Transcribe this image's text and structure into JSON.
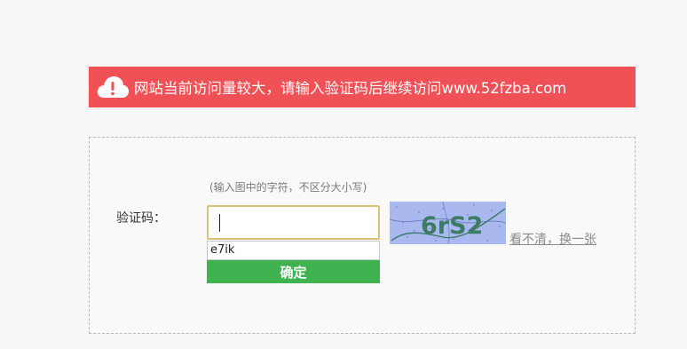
{
  "banner": {
    "icon": "cloud-alert-icon",
    "message": "网站当前访问量较大，请输入验证码后继续访问www.52fzba.com",
    "color": "#ef5156"
  },
  "form": {
    "hint": "(输入图中的字符，不区分大小写)",
    "label": "验证码：",
    "input_value": "",
    "suggestion": "e7ik",
    "submit_label": "确定",
    "submit_color": "#3fb34f",
    "captcha_text": "6rS2",
    "refresh_link": "看不清，换一张"
  }
}
